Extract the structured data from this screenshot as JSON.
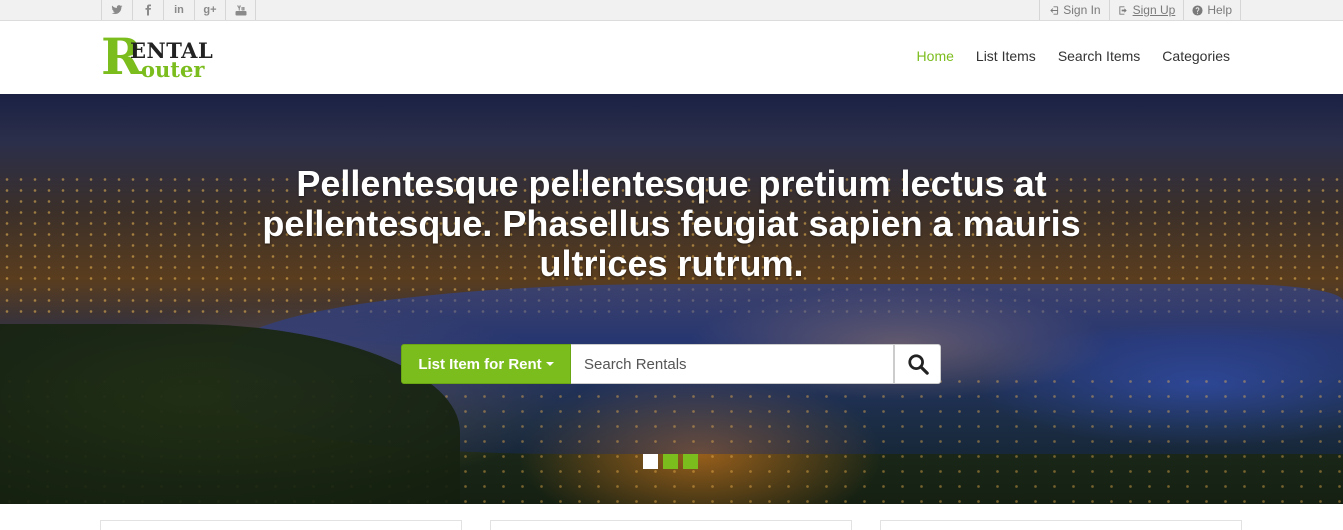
{
  "social": [
    {
      "name": "twitter-icon"
    },
    {
      "name": "facebook-icon"
    },
    {
      "name": "linkedin-icon",
      "label": "in"
    },
    {
      "name": "googleplus-icon",
      "label": "g+"
    },
    {
      "name": "youtube-icon"
    }
  ],
  "utility": {
    "sign_in": "Sign In",
    "sign_up": "Sign Up",
    "help": "Help"
  },
  "logo": {
    "letter": "R",
    "word1": "ENTAL",
    "word2": "outer"
  },
  "nav": {
    "home": "Home",
    "list_items": "List Items",
    "search_items": "Search Items",
    "categories": "Categories"
  },
  "hero": {
    "headline": "Pellentesque pellentesque pretium lectus at pellentesque. Phasellus feugiat sapien a mauris ultrices rutrum.",
    "list_button": "List Item for Rent",
    "search_placeholder": "Search Rentals",
    "slides_count": 3,
    "active_slide": 1
  },
  "colors": {
    "accent": "#7cbd1e",
    "text": "#333333"
  }
}
